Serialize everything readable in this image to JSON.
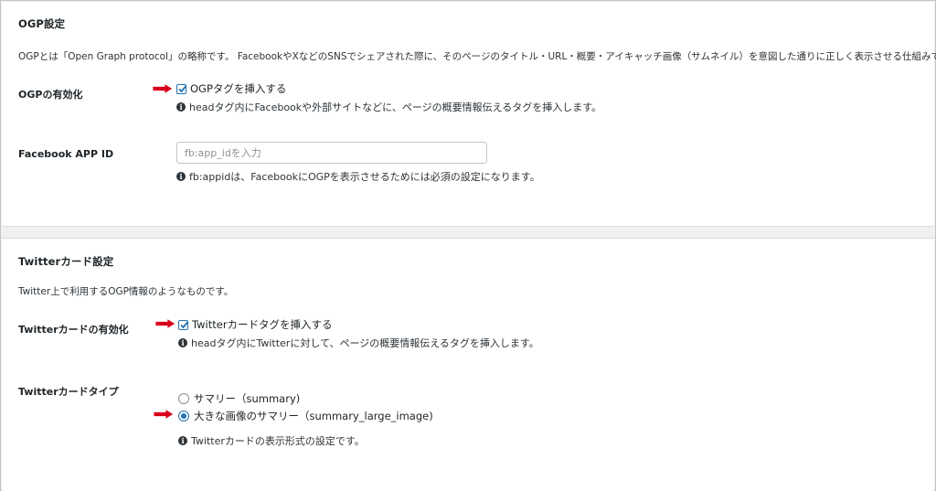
{
  "ogp": {
    "title": "OGP設定",
    "description": "OGPとは「Open Graph protocol」の略称です。 FacebookやXなどのSNSでシェアされた際に、そのページのタイトル・URL・概要・アイキャッチ画像（サムネイル）を意図した通りに正しく表示させる仕組みです。",
    "enable": {
      "label": "OGPの有効化",
      "checkbox_label": "OGPタグを挿入する",
      "checked": true,
      "help": "headタグ内にFacebookや外部サイトなどに、ページの概要情報伝えるタグを挿入します。"
    },
    "app_id": {
      "label": "Facebook APP ID",
      "value": "",
      "placeholder": "fb:app_idを入力",
      "help": "fb:appidは、FacebookにOGPを表示させるためには必須の設定になります。"
    }
  },
  "twitter": {
    "title": "Twitterカード設定",
    "description": "Twitter上で利用するOGP情報のようなものです。",
    "enable": {
      "label": "Twitterカードの有効化",
      "checkbox_label": "Twitterカードタグを挿入する",
      "checked": true,
      "help": "headタグ内にTwitterに対して、ページの概要情報伝えるタグを挿入します。"
    },
    "card_type": {
      "label": "Twitterカードタイプ",
      "options": [
        {
          "label": "サマリー（summary)",
          "checked": false
        },
        {
          "label": "大きな画像のサマリー（summary_large_image)",
          "checked": true
        }
      ],
      "help": "Twitterカードの表示形式の設定です。"
    }
  },
  "icons": {
    "info": "info-icon",
    "check": "check-icon",
    "annotation_arrow": "red-arrow-icon"
  },
  "colors": {
    "accent": "#2271b1",
    "annotation": "#d9001b",
    "text": "#1d2327"
  }
}
